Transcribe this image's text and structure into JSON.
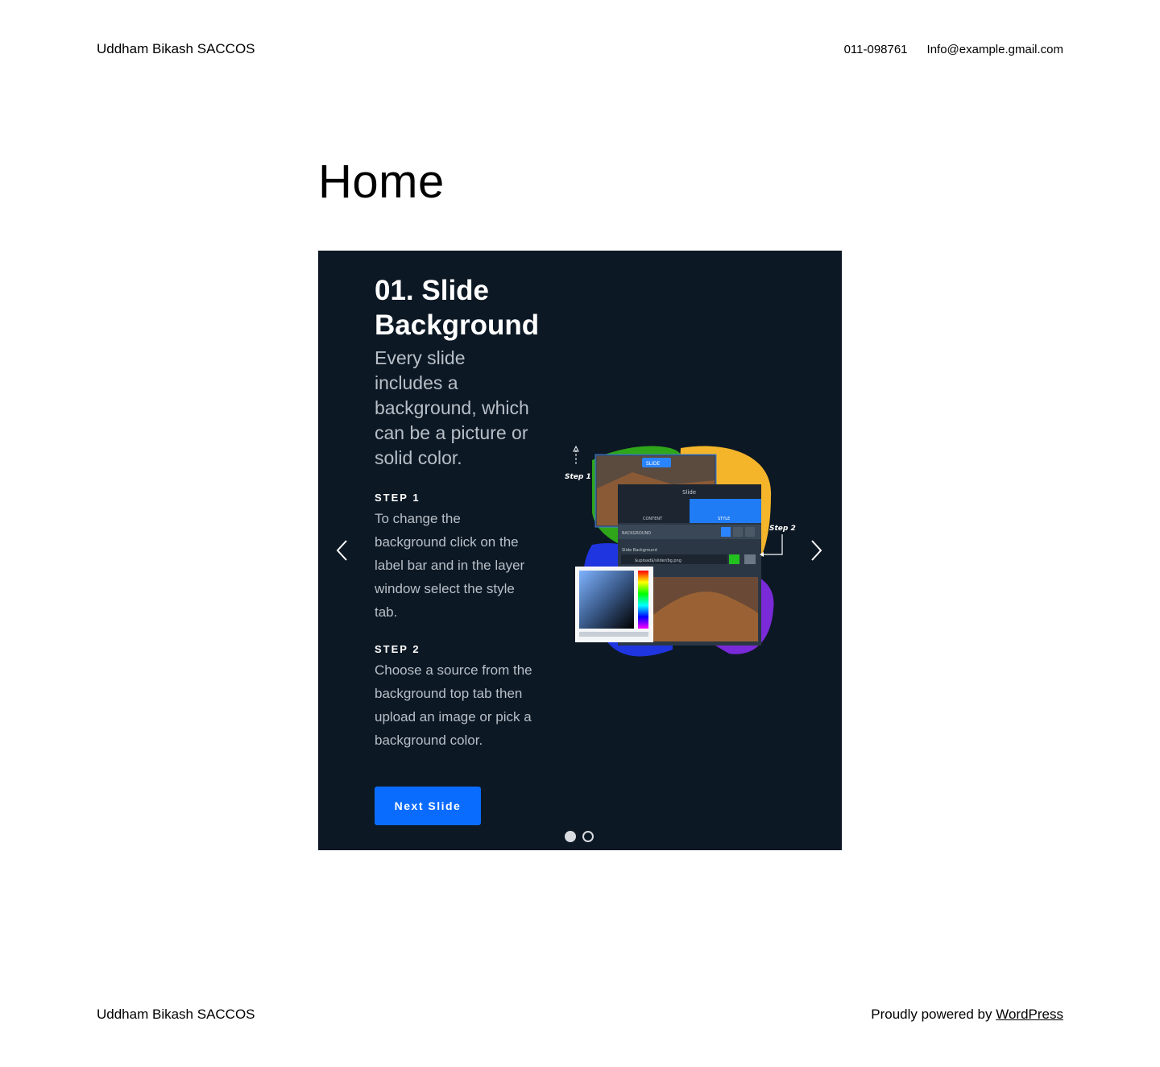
{
  "header": {
    "site_title": "Uddham Bikash SACCOS",
    "phone": "011-098761",
    "email": "Info@example.gmail.com"
  },
  "page": {
    "title": "Home"
  },
  "slider": {
    "heading": "01. Slide Background",
    "lead": "Every slide includes a background, which can be a picture or solid color.",
    "steps": [
      {
        "label": "STEP 1",
        "text": "To change the background click on the label bar and in the layer window select the style tab."
      },
      {
        "label": "STEP 2",
        "text": "Choose a source from the background top tab then upload an image or pick a background color."
      }
    ],
    "button_label": "Next Slide",
    "dots": {
      "count": 2,
      "active": 1
    },
    "illustration": {
      "step1_label": "Step 1",
      "step2_label": "Step 2",
      "slide_pill": "SLIDE",
      "panel_title": "Slide",
      "tab_content": "CONTENT",
      "tab_style": "STYLE",
      "row_background": "BACKGROUND",
      "field_label": "Slide Background",
      "field_value": "$upload$/slider/bg.png"
    },
    "colors": {
      "background": "#0c1824",
      "button": "#0a6cff"
    }
  },
  "footer": {
    "site_title": "Uddham Bikash SACCOS",
    "powered_prefix": "Proudly powered by",
    "powered_link": "WordPress"
  }
}
